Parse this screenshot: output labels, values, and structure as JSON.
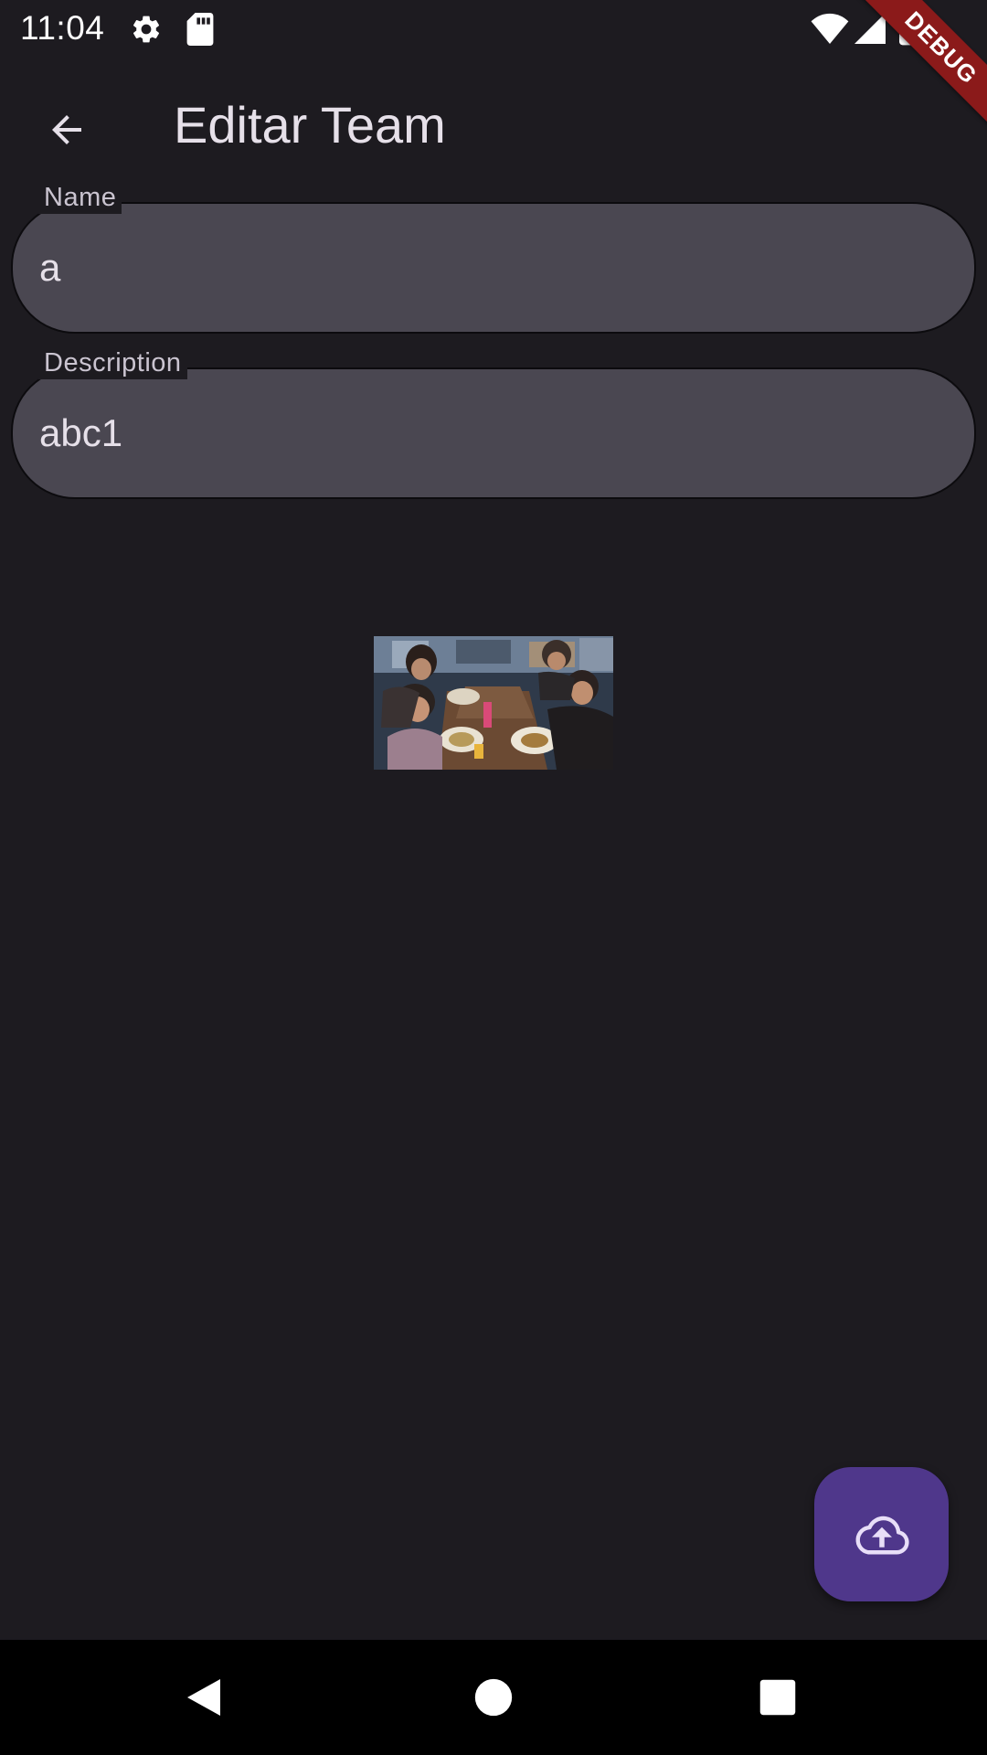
{
  "status_bar": {
    "time": "11:04",
    "icons": [
      "gear-icon",
      "sd-card-icon",
      "wifi-icon",
      "cell-signal-icon",
      "battery-icon"
    ]
  },
  "debug_banner": {
    "label": "DEBUG",
    "color": "#8b1a1a"
  },
  "app_bar": {
    "title": "Editar Team",
    "back_icon": "arrow-back-icon"
  },
  "form": {
    "name": {
      "label": "Name",
      "value": "a"
    },
    "description": {
      "label": "Description",
      "value": "abc1"
    }
  },
  "team_photo": {
    "icon": "team-photo-image"
  },
  "fab": {
    "icon": "cloud-upload-icon",
    "color": "#4f378b"
  },
  "nav_bar": {
    "buttons": [
      "back-triangle-icon",
      "home-circle-icon",
      "recents-square-icon"
    ]
  },
  "colors": {
    "background": "#1d1b20",
    "field_fill": "#4a4751",
    "text": "#e6e0e9",
    "label": "#cac4d0"
  }
}
